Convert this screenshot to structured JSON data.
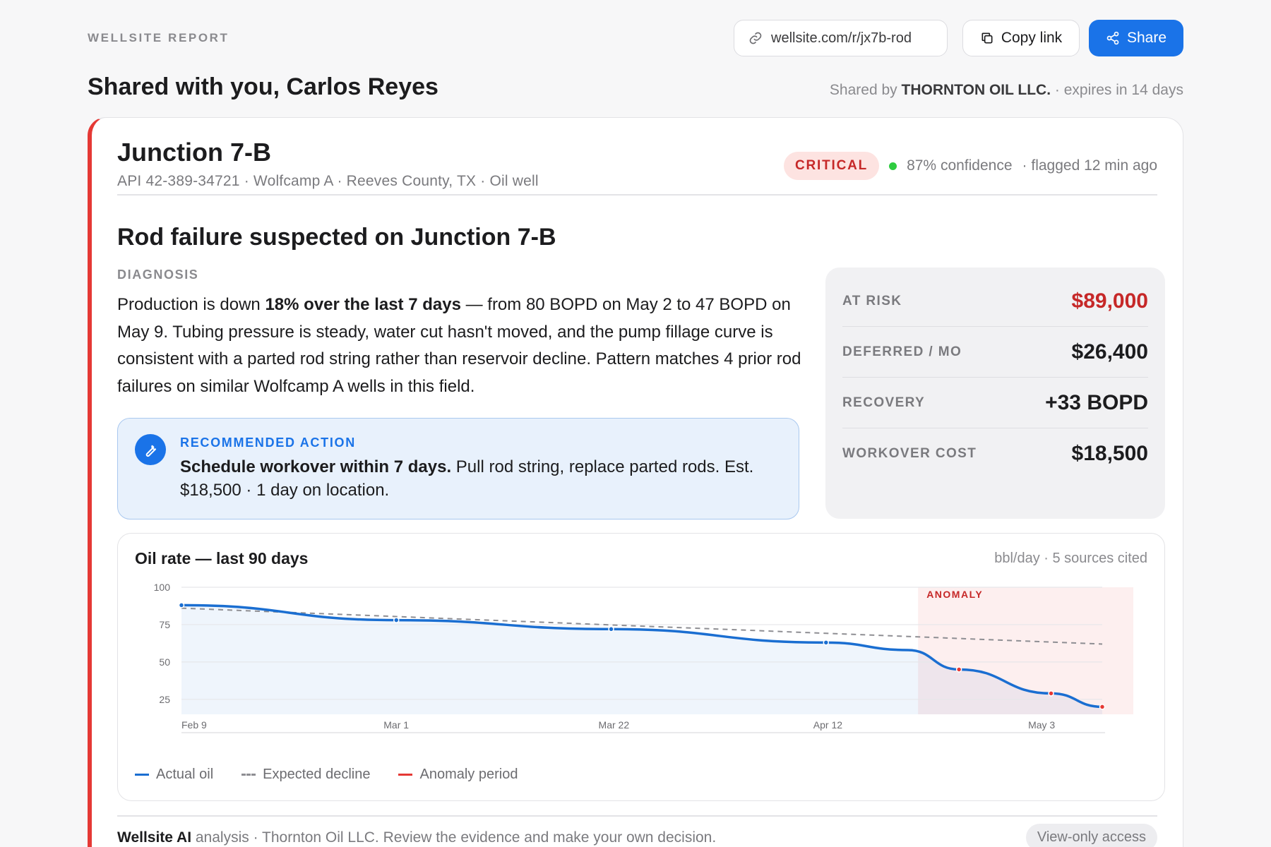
{
  "header": {
    "eyebrow": "WELLSITE REPORT",
    "url": "wellsite.com/r/jx7b-rod",
    "copy_label": "Copy link",
    "share_label": "Share",
    "greeting": "Shared with you, Carlos Reyes",
    "shared_by_prefix": "Shared by ",
    "shared_by_org": "THORNTON OIL LLC.",
    "shared_by_suffix": " · expires in 14 days"
  },
  "well": {
    "name": "Junction 7-B",
    "meta": "API 42-389-34721 · Wolfcamp A · Reeves County, TX · Oil well",
    "severity": "CRITICAL",
    "confidence": "87% confidence",
    "flagged": "· flagged 12 min ago",
    "severity_color": "#c62828"
  },
  "report": {
    "headline": "Rod failure suspected on Junction 7-B",
    "diagnosis_label": "DIAGNOSIS",
    "diagnosis_pre": "Production is down ",
    "diagnosis_bold": "18% over the last 7 days",
    "diagnosis_post": " — from 80 BOPD on May 2 to 47 BOPD on May 9. Tubing pressure is steady, water cut hasn't moved, and the pump fillage curve is consistent with a parted rod string rather than reservoir decline. Pattern matches 4 prior rod failures on similar Wolfcamp A wells in this field.",
    "action_label": "RECOMMENDED ACTION",
    "action_bold": "Schedule workover within 7 days.",
    "action_text": " Pull rod string, replace parted rods. Est. $18,500 · 1 day on location."
  },
  "metrics": [
    {
      "label": "AT RISK",
      "value": "$89,000"
    },
    {
      "label": "DEFERRED / MO",
      "value": "$26,400"
    },
    {
      "label": "RECOVERY",
      "value": "+33 BOPD"
    },
    {
      "label": "WORKOVER COST",
      "value": "$18,500"
    }
  ],
  "chart_data": {
    "type": "line",
    "title": "Oil rate — last 90 days",
    "subtitle": "bbl/day · 5 sources cited",
    "xlabel": "",
    "ylabel": "",
    "x_ticks": [
      "Feb 9",
      "Mar 1",
      "Mar 22",
      "Apr 12",
      "May 3"
    ],
    "y_ticks": [
      100,
      75,
      50,
      25
    ],
    "ylim": [
      15,
      100
    ],
    "xlim": [
      "2024-02-09",
      "2024-05-09"
    ],
    "grid": true,
    "annotation": "ANOMALY",
    "anomaly_range": [
      "2024-04-21",
      "2024-05-09"
    ],
    "series": [
      {
        "name": "Actual oil",
        "color": "#1a6ed1",
        "points": [
          {
            "x": "2024-02-09",
            "y": 88
          },
          {
            "x": "2024-03-01",
            "y": 78
          },
          {
            "x": "2024-03-22",
            "y": 72
          },
          {
            "x": "2024-04-12",
            "y": 63
          },
          {
            "x": "2024-04-20",
            "y": 58
          },
          {
            "x": "2024-04-25",
            "y": 45
          },
          {
            "x": "2024-05-04",
            "y": 29
          },
          {
            "x": "2024-05-09",
            "y": 20
          }
        ]
      },
      {
        "name": "Expected decline",
        "color": "#8e8e93",
        "points": [
          {
            "x": "2024-02-09",
            "y": 86
          },
          {
            "x": "2024-05-09",
            "y": 62
          }
        ]
      }
    ],
    "legend": [
      "Actual oil",
      "Expected decline",
      "Anomaly period"
    ],
    "anomaly_color": "#e53935"
  },
  "footer": {
    "brand": "Wellsite AI",
    "text": " analysis · Thornton Oil LLC. Review the evidence and make your own decision.",
    "access": "View-only access"
  }
}
